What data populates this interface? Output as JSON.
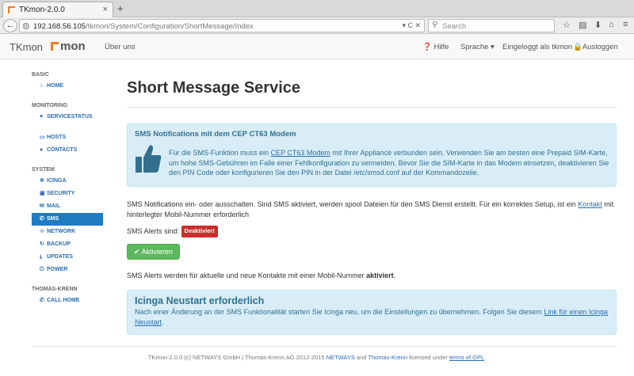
{
  "browser": {
    "tab_title": "TKmon-2.0.0",
    "tab_close": "×",
    "new_tab": "+",
    "url_host": "192.168.56.105",
    "url_path": "/tkmon/System/Configuration/ShortMessage/Index",
    "url_prefix": "",
    "search_placeholder": "Search",
    "url_icons": "▾ C ✕"
  },
  "header": {
    "brand": "TKmon",
    "logo": "mon",
    "about": "Über uns",
    "help": "Hilfe",
    "language": "Sprache",
    "logged_in": "Eingeloggt als tkmon",
    "logout": "Ausloggen"
  },
  "sidebar": {
    "sections": {
      "basic": "BASIC",
      "monitoring": "MONITORING",
      "system": "SYSTEM",
      "thomaskrenn": "THOMAS-KRENN"
    },
    "items": {
      "home": "HOME",
      "servicestatus": "SERVICESTATUS",
      "hosts": "HOSTS",
      "contacts": "CONTACTS",
      "icinga": "ICINGA",
      "security": "SECURITY",
      "mail": "MAIL",
      "sms": "SMS",
      "network": "NETWORK",
      "backup": "BACKUP",
      "updates": "UPDATES",
      "power": "POWER",
      "callhome": "CALL HOME"
    }
  },
  "main": {
    "title": "Short Message Service",
    "alert1": {
      "title": "SMS Notifications mit dem CEP CT63 Modem",
      "body_pre": "Für die SMS-Funktion muss ein ",
      "body_link": "CEP CT63 Modem",
      "body_post": " mit Ihrer Appliance verbunden sein. Verwenden Sie am besten eine Prepaid SIM-Karte, um hohe SMS-Gebühren im Falle einer Fehlkonfiguration zu vermeiden. Bevor Sie die SIM-Karte in das Modem einsetzen, deaktivieren Sie den PIN Code oder konfigurieren Sie den PIN in der Datei /etc/smsd.conf auf der Kommandozeile."
    },
    "intro_pre": "SMS Notifications ein- oder ausschalten. Sind SMS aktiviert, werden spool Dateien für den SMS Dienst erstellt. Für ein korrektes Setup, ist ein ",
    "intro_link": "Kontakt",
    "intro_post": " mit hinterlegter Mobil-Nummer erforderlich",
    "status_label": "SMS Alerts sind:",
    "status_badge": "Deaktiviert",
    "activate_button": "Aktivieren",
    "info_pre": "SMS Alerts werden für aktuelle und neue Kontakte mit einer Mobil-Nummer ",
    "info_bold": "aktiviert",
    "info_post": ".",
    "alert2": {
      "title": "Icinga Neustart erforderlich",
      "body_pre": "Nach einer Änderung an der SMS Funktionalität starten Sie Icinga neu, um die Einstellungen zu übernehmen. Folgen Sie diesem ",
      "body_link": "Link für einen Icinga Neustart",
      "body_post": "."
    }
  },
  "footer": {
    "pre": "TKmon-2.0.0 (c) NETWAYS GmbH | Thomas-Krenn.AG 2012-2015 ",
    "netways": "NETWAYS",
    "and": " and ",
    "tk": "Thomas-Krenn",
    "mid": " licensed under ",
    "gpl": "terms of GPL",
    "end": "."
  },
  "colors": {
    "accent": "#1f7bc2",
    "success": "#5cb85c",
    "danger": "#c9302c",
    "info_bg": "#d9edf7",
    "info_text": "#31708f",
    "brand_orange": "#f47b20"
  }
}
